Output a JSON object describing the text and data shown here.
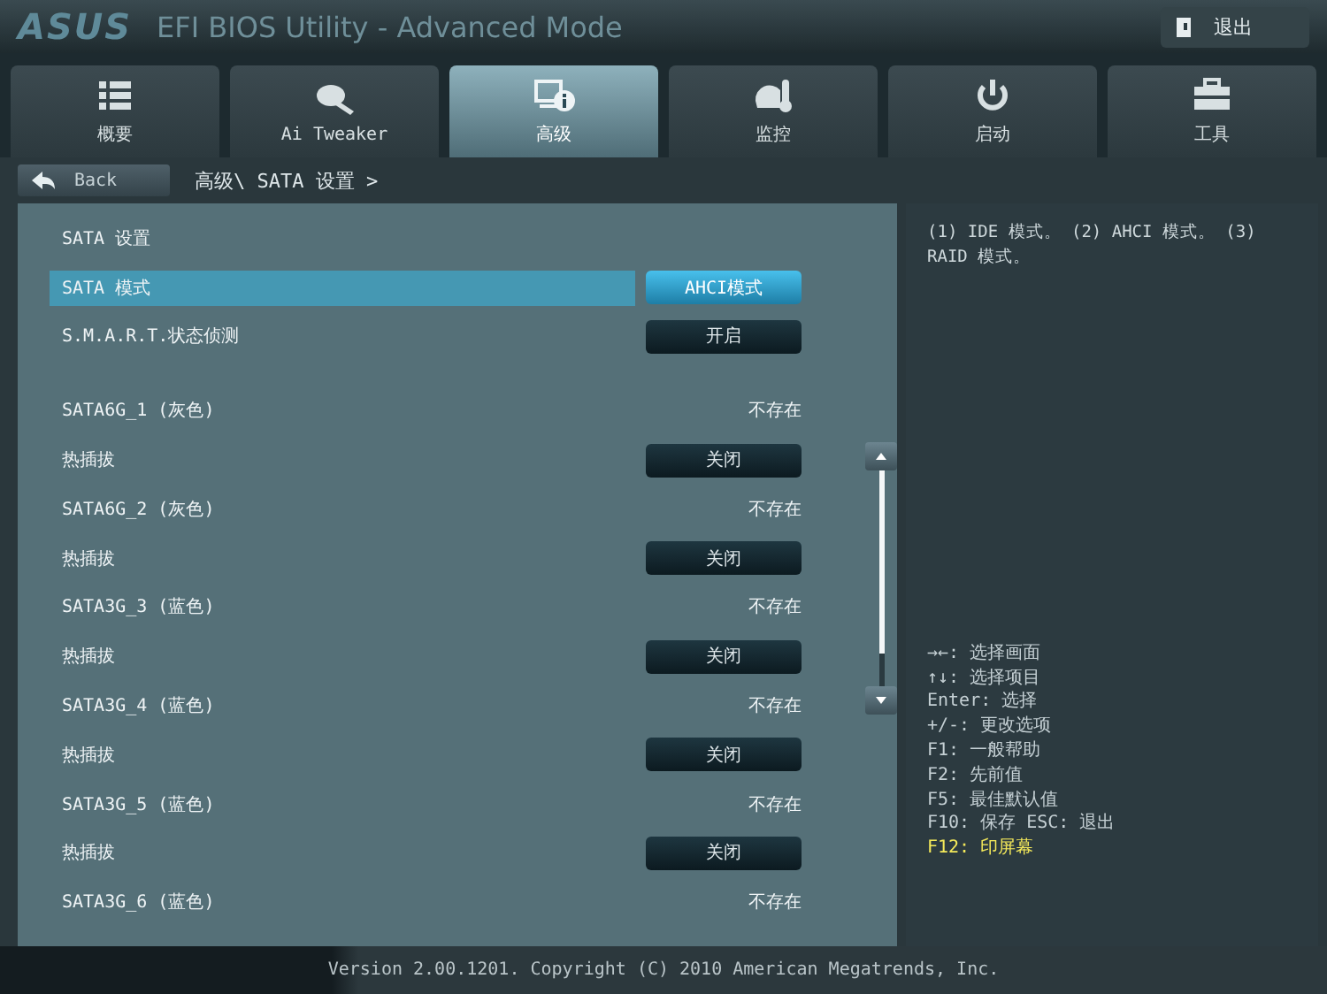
{
  "header": {
    "logo": "ASUS",
    "title": "EFI BIOS Utility - Advanced Mode",
    "exit_button": "退出"
  },
  "tabs": [
    {
      "label": "概要",
      "selected": false
    },
    {
      "label": "Ai Tweaker",
      "selected": false
    },
    {
      "label": "高级",
      "selected": true
    },
    {
      "label": "监控",
      "selected": false
    },
    {
      "label": "启动",
      "selected": false
    },
    {
      "label": "工具",
      "selected": false
    }
  ],
  "nav": {
    "back_button": "Back",
    "breadcrumb": "高级\\ SATA 设置 >"
  },
  "settings": [
    {
      "kind": "heading",
      "label": "SATA 设置"
    },
    {
      "kind": "option",
      "label": "SATA 模式",
      "value": "AHCI模式",
      "selected": true
    },
    {
      "kind": "option",
      "label": "S.M.A.R.T.状态侦测",
      "value": "开启",
      "selected": false
    },
    {
      "kind": "gap"
    },
    {
      "kind": "status",
      "label": "SATA6G_1 (灰色)",
      "value": "不存在"
    },
    {
      "kind": "option",
      "label": "热插拔",
      "value": "关闭",
      "selected": false
    },
    {
      "kind": "status",
      "label": "SATA6G_2 (灰色)",
      "value": "不存在"
    },
    {
      "kind": "option",
      "label": "热插拔",
      "value": "关闭",
      "selected": false
    },
    {
      "kind": "status",
      "label": "SATA3G_3 (蓝色)",
      "value": "不存在"
    },
    {
      "kind": "option",
      "label": "热插拔",
      "value": "关闭",
      "selected": false
    },
    {
      "kind": "status",
      "label": "SATA3G_4 (蓝色)",
      "value": "不存在"
    },
    {
      "kind": "option",
      "label": "热插拔",
      "value": "关闭",
      "selected": false
    },
    {
      "kind": "status",
      "label": "SATA3G_5 (蓝色)",
      "value": "不存在"
    },
    {
      "kind": "option",
      "label": "热插拔",
      "value": "关闭",
      "selected": false
    },
    {
      "kind": "status",
      "label": "SATA3G_6 (蓝色)",
      "value": "不存在"
    }
  ],
  "help_text": "(1) IDE 模式。 (2) AHCI 模式。 (3) RAID 模式。",
  "key_help": [
    {
      "text": "→←: 选择画面",
      "highlighted": false
    },
    {
      "text": "↑↓: 选择项目",
      "highlighted": false
    },
    {
      "text": "Enter: 选择",
      "highlighted": false
    },
    {
      "text": "+/-: 更改选项",
      "highlighted": false
    },
    {
      "text": "F1: 一般帮助",
      "highlighted": false
    },
    {
      "text": "F2: 先前值",
      "highlighted": false
    },
    {
      "text": "F5: 最佳默认值",
      "highlighted": false
    },
    {
      "text": "F10: 保存  ESC: 退出",
      "highlighted": false
    },
    {
      "text": "F12: 印屏幕",
      "highlighted": true
    }
  ],
  "footer": "Version 2.00.1201. Copyright (C) 2010 American Megatrends, Inc."
}
